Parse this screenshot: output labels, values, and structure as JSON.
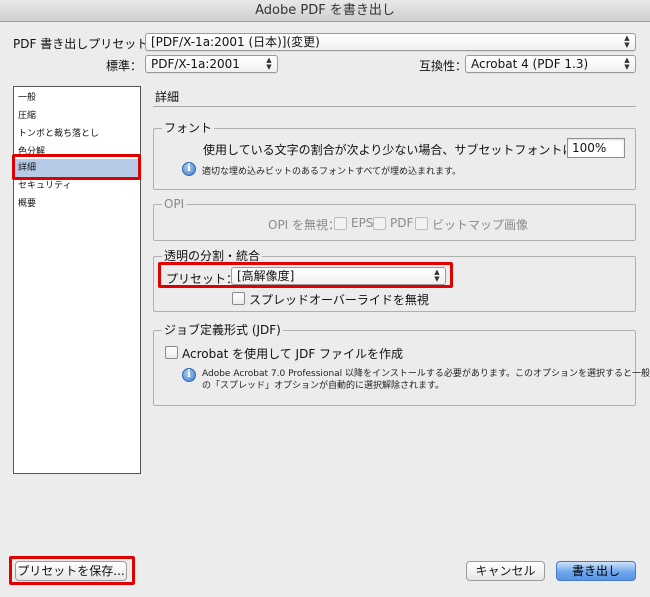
{
  "window": {
    "title": "Adobe PDF を書き出し"
  },
  "preset_row": {
    "label": "PDF 書き出しプリセット：",
    "value": "[PDF/X-1a:2001 (日本)](変更)"
  },
  "standard_row": {
    "label": "標準：",
    "value": "PDF/X-1a:2001",
    "compat_label": "互換性：",
    "compat_value": "Acrobat 4 (PDF 1.3)"
  },
  "sidebar": {
    "items": [
      {
        "label": "一般"
      },
      {
        "label": "圧縮"
      },
      {
        "label": "トンボと裁ち落とし"
      },
      {
        "label": "色分解"
      },
      {
        "label": "詳細",
        "selected": true
      },
      {
        "label": "セキュリティ"
      },
      {
        "label": "概要"
      }
    ]
  },
  "detail": {
    "section_title": "詳細",
    "font_group": {
      "title": "フォント",
      "subset_label": "使用している文字の割合が次より少ない場合、サブセットフォントにする：",
      "subset_value": "100%",
      "info_text": "適切な埋め込みビットのあるフォントすべてが埋め込まれます。"
    },
    "opi_group": {
      "title": "OPI",
      "ignore_label": "OPI を無視：",
      "eps_label": "EPS",
      "pdf_label": "PDF",
      "bitmap_label": "ビットマップ画像"
    },
    "transparency_group": {
      "title": "透明の分割・統合",
      "preset_label": "プリセット：",
      "preset_value": "[高解像度]",
      "ignore_spread_label": "スプレッドオーバーライドを無視"
    },
    "jdf_group": {
      "title": "ジョブ定義形式 (JDF)",
      "create_jdf_label": "Acrobat を使用して JDF ファイルを作成",
      "info_line1": "Adobe Acrobat 7.0 Professional 以降をインストールする必要があります。このオプションを選択すると一般パネル",
      "info_line2": "の「スプレッド」オプションが自動的に選択解除されます。"
    }
  },
  "footer": {
    "save_preset_label": "プリセットを保存...",
    "cancel_label": "キャンセル",
    "export_label": "書き出し"
  },
  "colors": {
    "highlight_box": "#e00000",
    "selection": "#b5cbe8",
    "default_button": "#5795e6"
  }
}
